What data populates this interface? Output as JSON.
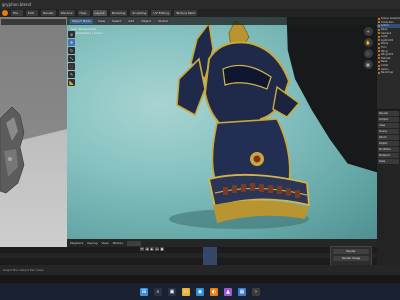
{
  "window": {
    "title": "gryphon.blend"
  },
  "menubar": {
    "tabs": [
      "File",
      "Edit",
      "Render",
      "Window",
      "Help",
      "Layout",
      "Modeling",
      "Sculpting",
      "UV Editing",
      "Texture Paint"
    ],
    "active_tab": "Layout"
  },
  "viewport": {
    "header_items": [
      "Object Mode",
      "View",
      "Select",
      "Add",
      "Object",
      "Global"
    ],
    "info_lines": [
      "User Perspective",
      "(1) Collection | Armor"
    ],
    "tools": [
      "cursor-icon",
      "move-icon",
      "rotate-icon",
      "scale-icon",
      "transform-icon",
      "annotate-icon",
      "measure-icon"
    ],
    "gizmo": [
      "+",
      "✋",
      "🎥",
      "▦"
    ]
  },
  "outliner": {
    "rows": [
      {
        "label": "Scene Collection",
        "selected": false
      },
      {
        "label": "Collection",
        "selected": false
      },
      {
        "label": "Armor",
        "selected": true
      },
      {
        "label": "Base",
        "selected": false
      },
      {
        "label": "Camera",
        "selected": false
      },
      {
        "label": "Light",
        "selected": false
      },
      {
        "label": "Light.001",
        "selected": false
      },
      {
        "label": "Plane",
        "selected": false
      },
      {
        "label": "Trim",
        "selected": false
      },
      {
        "label": "Wing",
        "selected": false
      },
      {
        "label": "Wing.001",
        "selected": false
      },
      {
        "label": "Helmet",
        "selected": false
      },
      {
        "label": "Beak",
        "selected": false
      },
      {
        "label": "Collar",
        "selected": false
      },
      {
        "label": "Gems",
        "selected": false
      },
      {
        "label": "Backdrop",
        "selected": false
      }
    ]
  },
  "properties": {
    "rows": [
      "Render",
      "Output",
      "View",
      "Scene",
      "World",
      "Object",
      "Modifiers",
      "Material",
      "Data"
    ]
  },
  "timeline": {
    "header_items": [
      "Playback",
      "Keying",
      "View",
      "Marker"
    ],
    "controls": [
      "⏮",
      "◀",
      "▶",
      "⏭",
      "●"
    ]
  },
  "render_popup": {
    "rows": [
      "Render",
      "Render Image"
    ]
  },
  "statusbar": {
    "text": "Select   Box Select   Pan View"
  },
  "taskbar": {
    "icons": [
      {
        "name": "windows-start-icon",
        "glyph": "⊞",
        "color": "#3b8fe0"
      },
      {
        "name": "search-icon",
        "glyph": "⌕",
        "color": "#2b3245"
      },
      {
        "name": "task-view-icon",
        "glyph": "▣",
        "color": "#2b3245"
      },
      {
        "name": "file-explorer-icon",
        "glyph": "▭",
        "color": "#e8b43a"
      },
      {
        "name": "browser-icon",
        "glyph": "◉",
        "color": "#2f8fd8"
      },
      {
        "name": "blender-icon",
        "glyph": "◐",
        "color": "#e87d0d"
      },
      {
        "name": "photos-icon",
        "glyph": "▲",
        "color": "#9a5bd4"
      },
      {
        "name": "store-icon",
        "glyph": "▦",
        "color": "#3a7bd5"
      },
      {
        "name": "terminal-icon",
        "glyph": "›",
        "color": "#3d3d3d"
      }
    ]
  },
  "colors": {
    "viewport_background": "#7cb9b8",
    "accent_blue": "#4772b3",
    "blender_orange": "#e87d0d",
    "gold_trim": "#c9a83c",
    "armor_dark": "#1f2a4a"
  }
}
